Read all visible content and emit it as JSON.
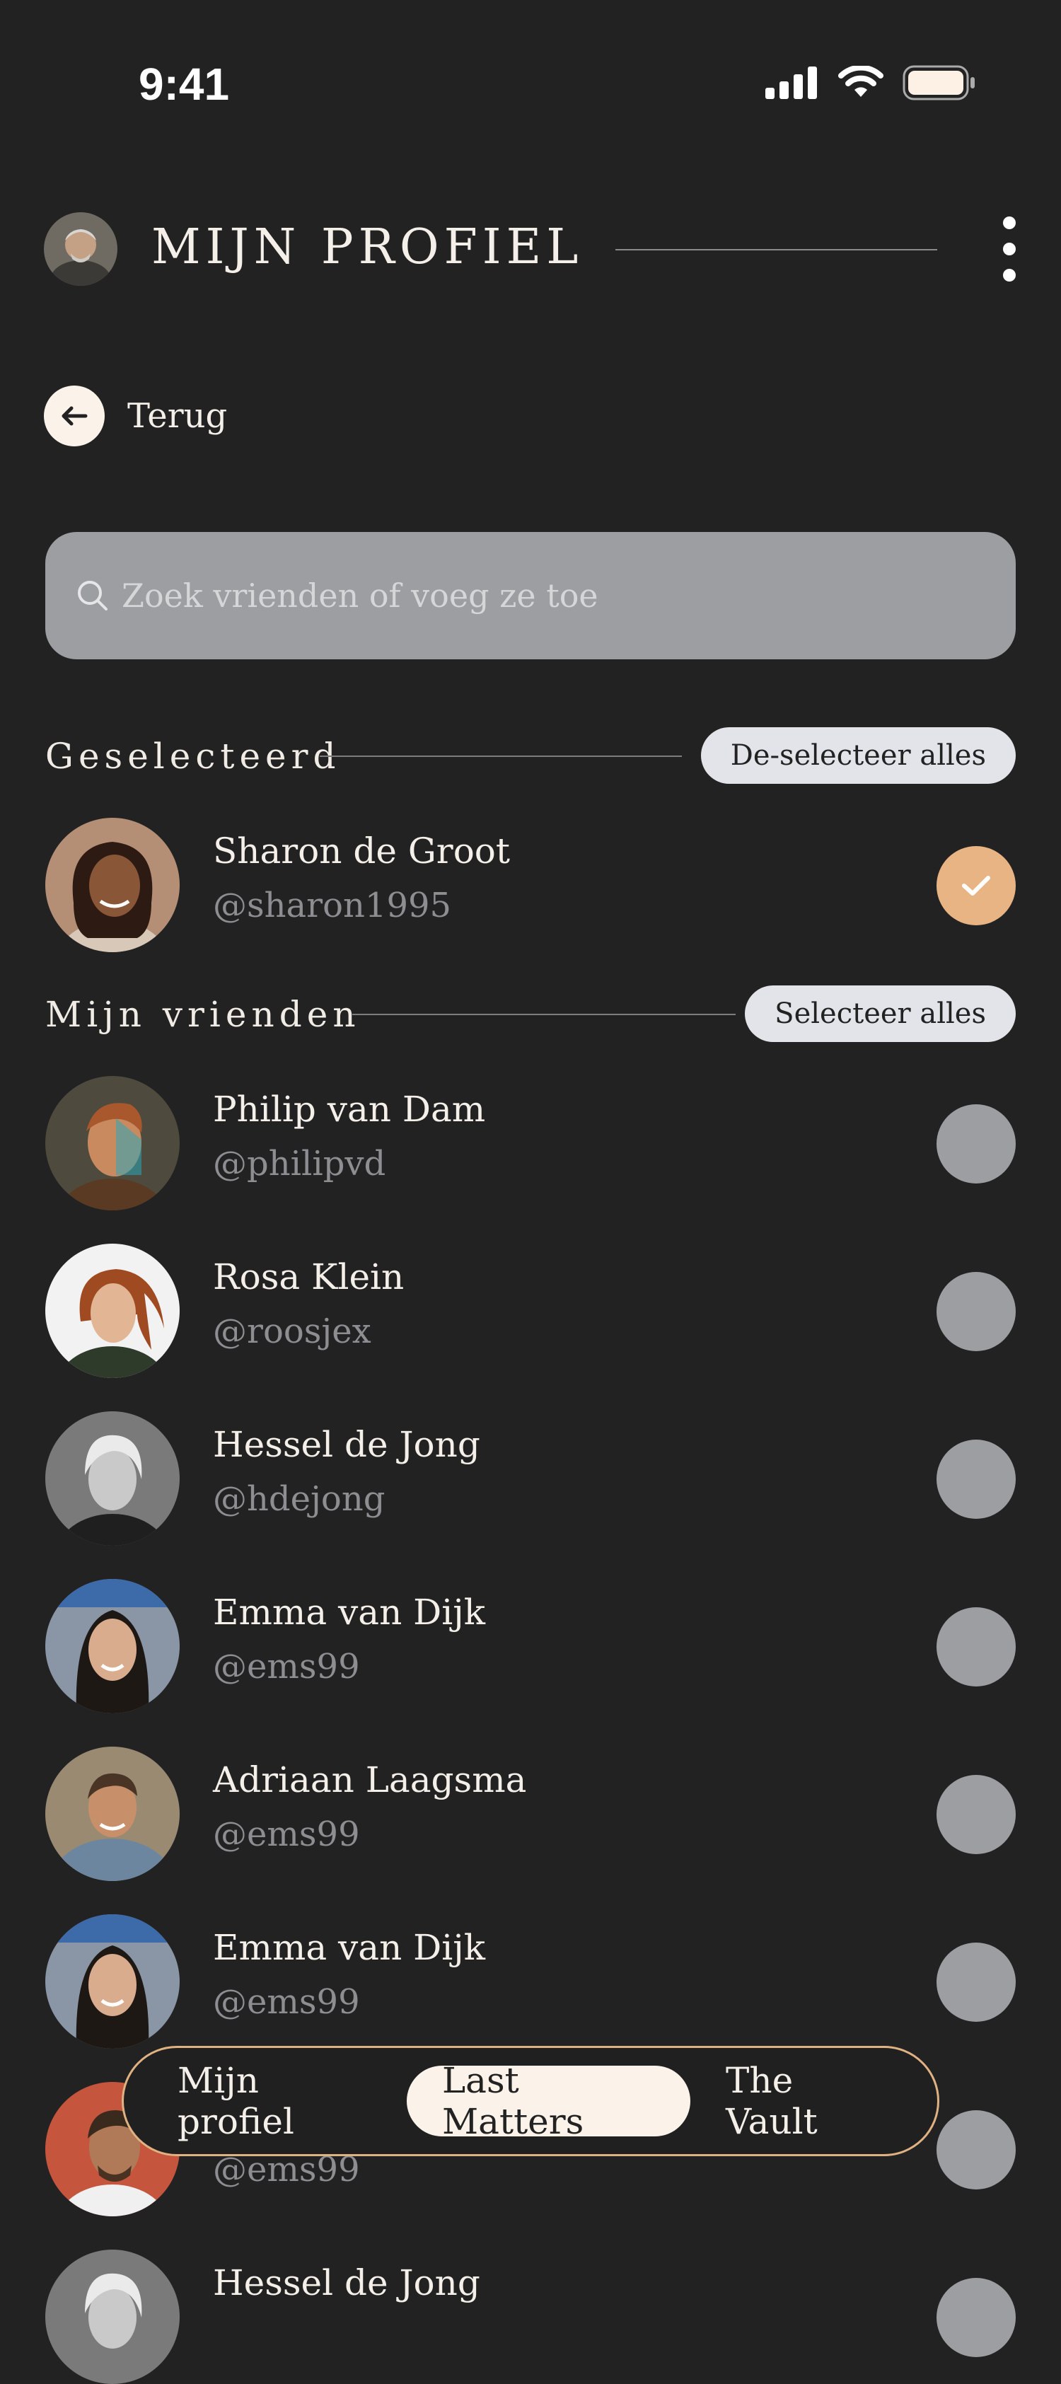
{
  "status": {
    "time": "9:41"
  },
  "header": {
    "title": "MIJN PROFIEL"
  },
  "back": {
    "label": "Terug"
  },
  "search": {
    "placeholder": "Zoek vrienden of voeg ze toe"
  },
  "selected_section": {
    "title": "Geselecteerd",
    "action": "De-selecteer alles"
  },
  "friends_section": {
    "title": "Mijn vrienden",
    "action": "Selecteer alles"
  },
  "selected": [
    {
      "name": "Sharon de Groot",
      "handle": "@sharon1995",
      "checked": true
    }
  ],
  "friends": [
    {
      "name": "Philip van Dam",
      "handle": "@philipvd",
      "checked": false
    },
    {
      "name": "Rosa Klein",
      "handle": "@roosjex",
      "checked": false
    },
    {
      "name": "Hessel de Jong",
      "handle": "@hdejong",
      "checked": false
    },
    {
      "name": "Emma van Dijk",
      "handle": "@ems99",
      "checked": false
    },
    {
      "name": "Adriaan Laagsma",
      "handle": "@ems99",
      "checked": false
    },
    {
      "name": "Emma van Dijk",
      "handle": "@ems99",
      "checked": false
    },
    {
      "name": "",
      "handle": "@ems99",
      "checked": false
    },
    {
      "name": "Hessel de Jong",
      "handle": "",
      "checked": false
    }
  ],
  "tabs": [
    {
      "label": "Mijn profiel",
      "active": false
    },
    {
      "label": "Last Matters",
      "active": true
    },
    {
      "label": "The Vault",
      "active": false
    }
  ],
  "colors": {
    "background": "#222223",
    "accent": "#e8b484",
    "unselected": "#9d9ea2",
    "pill": "#e3e4ea"
  }
}
